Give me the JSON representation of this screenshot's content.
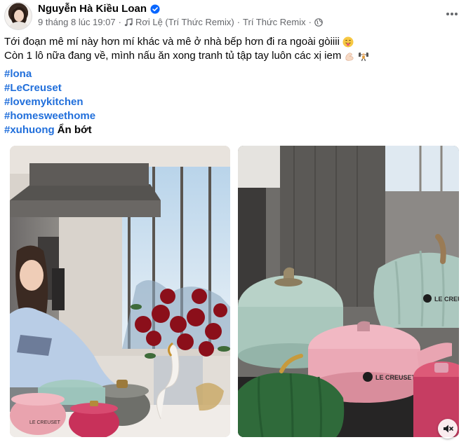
{
  "post": {
    "author": "Nguyễn Hà Kiều Loan",
    "date": "9 tháng 8 lúc 19:07",
    "separator": "·",
    "music_title": "Rơi Lệ (Trí Thức Remix)",
    "music_artist": "Trí Thức Remix",
    "caption_line1": "Tới đoạn mê mí này hơn mí khác và mê ở nhà bếp hơn đi ra ngoài gòiiii",
    "caption_line2": "Còn 1 lô nữa đang về, mình nấu ăn xong tranh tủ tập tay luôn các xị iem",
    "hashtags": [
      "#lona",
      "#LeCreuset",
      "#lovemykitchen",
      "#homesweethome",
      "#xuhuong"
    ],
    "see_less": "Ẩn bớt"
  },
  "photos": {
    "brand_text": "LE CREUSET"
  },
  "icons": {
    "verified": "verified-badge-icon",
    "music": "music-note-icon",
    "privacy": "globe-icon",
    "more": "more-options-icon",
    "mute": "speaker-muted-icon"
  },
  "colors": {
    "link": "#216fdb",
    "meta": "#65676b",
    "verified": "#0866ff"
  }
}
